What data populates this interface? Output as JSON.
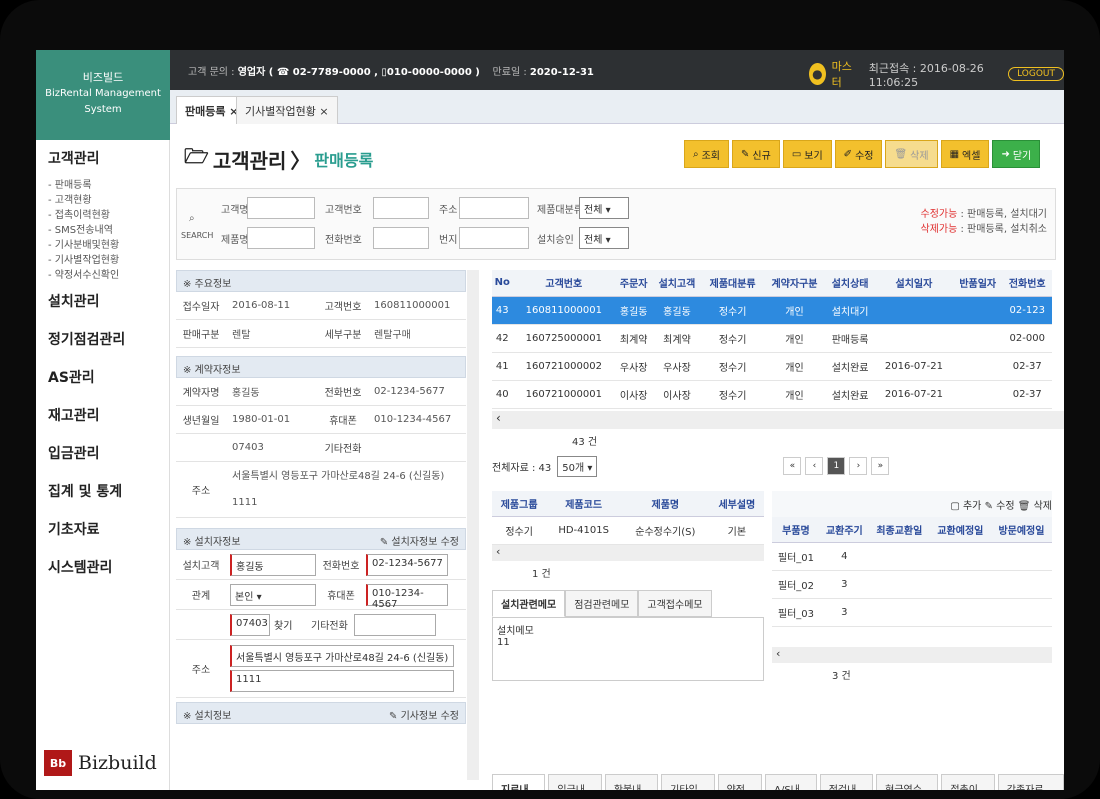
{
  "brand": {
    "line1": "비즈빌드",
    "line2": "BizRental Management System"
  },
  "header": {
    "contact_label": "고객 문의 :",
    "contact_value": "영업자 ( ☎ 02-7789-0000 , ▯010-0000-0000 )",
    "expiry_label": "만료일 :",
    "expiry_value": "2020-12-31",
    "user": "마스터",
    "last_login": "최근접속 : 2016-08-26 11:06:25",
    "logout": "LOGOUT"
  },
  "tabs": [
    "판매등록 ×",
    "기사별작업현황 ×"
  ],
  "sidebar": {
    "sections": [
      "고객관리",
      "설치관리",
      "정기점검관리",
      "AS관리",
      "재고관리",
      "입금관리",
      "집계 및 통계",
      "기초자료",
      "시스템관리"
    ],
    "sub": [
      "- 판매등록",
      "- 고객현황",
      "- 접촉이력현황",
      "- SMS전송내역",
      "- 기사분배및현황",
      "- 기사별작업현황",
      "- 약정서수신확인"
    ],
    "logo_text": "Bizbuild"
  },
  "page": {
    "title": "고객관리",
    "subtitle": "판매등록"
  },
  "toolbar": {
    "search": "조회",
    "new": "신규",
    "view": "보기",
    "edit": "수정",
    "delete": "삭제",
    "excel": "엑셀",
    "close": "닫기"
  },
  "search": {
    "label": "SEARCH",
    "customer_name": "고객명",
    "customer_no": "고객번호",
    "address": "주소",
    "product_cat": "제품대분류",
    "product_cat_val": "전체",
    "product_name": "제품명",
    "phone": "전화번호",
    "lot": "번지",
    "install_approve": "설치승인",
    "install_approve_val": "전체",
    "note1_red": "수정가능",
    "note1": " : 판매등록, 설치대기",
    "note2_red": "삭제가능",
    "note2": " : 판매등록, 설치취소"
  },
  "main_info": {
    "header": "※ 주요정보",
    "receipt_date_label": "접수일자",
    "receipt_date": "2016-08-11",
    "cust_no_label": "고객번호",
    "cust_no": "160811000001",
    "sale_type_label": "판매구분",
    "sale_type": "렌탈",
    "sub_type_label": "세부구분",
    "sub_type": "렌탈구매"
  },
  "contractor": {
    "header": "※ 계약자정보",
    "name_label": "계약자명",
    "name": "홍길동",
    "phone_label": "전화번호",
    "phone": "02-1234-5677",
    "birth_label": "생년월일",
    "birth": "1980-01-01",
    "mobile_label": "휴대폰",
    "mobile": "010-1234-4567",
    "zip": "07403",
    "other_label": "기타전화",
    "addr_label": "주소",
    "addr": "서울특별시 영등포구 가마산로48길 24-6 (신길동)",
    "addr2": "1111"
  },
  "install": {
    "header": "※ 설치자정보",
    "edit_label": "설치자정보 수정",
    "cust_label": "설치고객",
    "cust": "홍길동",
    "phone_label": "전화번호",
    "phone": "02-1234-5677",
    "rel_label": "관계",
    "rel": "본인",
    "mobile_label": "휴대폰",
    "mobile": "010-1234-4567",
    "zip": "07403",
    "find": "찾기",
    "other_label": "기타전화",
    "addr_label": "주소",
    "addr": "서울특별시 영등포구 가마산로48길 24-6 (신길동)",
    "addr2": "1111"
  },
  "tech": {
    "header": "※ 설치정보",
    "edit_label": "기사정보 수정"
  },
  "grid": {
    "headers": [
      "No",
      "고객번호",
      "주문자",
      "설치고객",
      "제품대분류",
      "계약자구분",
      "설치상태",
      "설치일자",
      "반품일자",
      "전화번호"
    ],
    "rows": [
      [
        "43",
        "160811000001",
        "홍길동",
        "홍길동",
        "정수기",
        "개인",
        "설치대기",
        "",
        "",
        "02-123"
      ],
      [
        "42",
        "160725000001",
        "최계약",
        "최계약",
        "정수기",
        "개인",
        "판매등록",
        "",
        "",
        "02-000"
      ],
      [
        "41",
        "160721000002",
        "우사장",
        "우사장",
        "정수기",
        "개인",
        "설치완료",
        "2016-07-21",
        "",
        "02-37"
      ],
      [
        "40",
        "160721000001",
        "이사장",
        "이사장",
        "정수기",
        "개인",
        "설치완료",
        "2016-07-21",
        "",
        "02-37"
      ]
    ],
    "count": "43 건",
    "total": "전체자료 : 43",
    "page_size": "50개",
    "page": "1"
  },
  "product": {
    "headers": [
      "제품그룹",
      "제품코드",
      "제품명",
      "세부설명"
    ],
    "row": [
      "정수기",
      "HD-4101S",
      "순수정수기(S)",
      "기본"
    ],
    "count": "1 건"
  },
  "parts": {
    "add": "추가",
    "edit": "수정",
    "delete": "삭제",
    "headers": [
      "부품명",
      "교환주기",
      "최종교환일",
      "교환예정일",
      "방문예정일"
    ],
    "rows": [
      [
        "필터_01",
        "4"
      ],
      [
        "필터_02",
        "3"
      ],
      [
        "필터_03",
        "3"
      ]
    ],
    "count": "3 건"
  },
  "memo": {
    "tabs": [
      "설치관련메모",
      "점검관련메모",
      "고객접수메모"
    ],
    "text1": "설치메모",
    "text2": "11"
  },
  "bottom_tabs": [
    "지로내역",
    "입금내역",
    "환불내역",
    "기타입금",
    "약정서",
    "A/S내역",
    "점검내역",
    "현금영수증",
    "접촉이력",
    "각종자료UP"
  ]
}
